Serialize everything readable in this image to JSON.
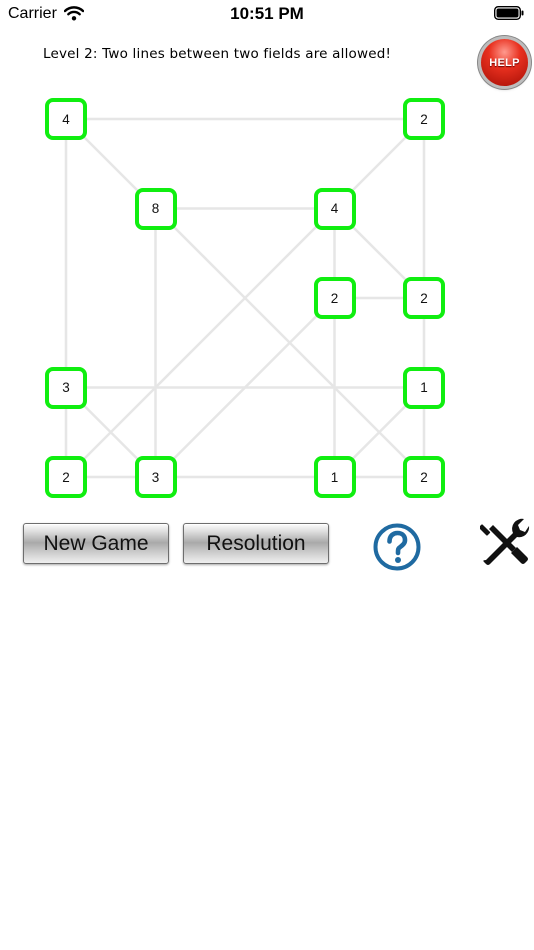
{
  "status_bar": {
    "carrier": "Carrier",
    "time": "10:51 PM"
  },
  "level_text": "Level 2: Two lines between two fields are allowed!",
  "help_button": "HELP",
  "nodes": [
    {
      "value": "4",
      "row": 0,
      "col": 0
    },
    {
      "value": "2",
      "row": 0,
      "col": 4
    },
    {
      "value": "8",
      "row": 1,
      "col": 1
    },
    {
      "value": "4",
      "row": 1,
      "col": 3
    },
    {
      "value": "2",
      "row": 2,
      "col": 3
    },
    {
      "value": "2",
      "row": 2,
      "col": 4
    },
    {
      "value": "3",
      "row": 3,
      "col": 0
    },
    {
      "value": "1",
      "row": 3,
      "col": 4
    },
    {
      "value": "2",
      "row": 4,
      "col": 0
    },
    {
      "value": "3",
      "row": 4,
      "col": 1
    },
    {
      "value": "1",
      "row": 4,
      "col": 3
    },
    {
      "value": "2",
      "row": 4,
      "col": 4
    }
  ],
  "connections": [
    [
      0,
      1
    ],
    [
      0,
      6
    ],
    [
      0,
      2
    ],
    [
      1,
      5
    ],
    [
      1,
      3
    ],
    [
      2,
      3
    ],
    [
      2,
      9
    ],
    [
      2,
      11
    ],
    [
      3,
      4
    ],
    [
      3,
      5
    ],
    [
      3,
      8
    ],
    [
      4,
      5
    ],
    [
      4,
      10
    ],
    [
      4,
      9
    ],
    [
      5,
      7
    ],
    [
      6,
      7
    ],
    [
      6,
      8
    ],
    [
      6,
      9
    ],
    [
      7,
      10
    ],
    [
      7,
      11
    ],
    [
      8,
      9
    ],
    [
      9,
      10
    ],
    [
      10,
      11
    ]
  ],
  "buttons": {
    "new_game": "New Game",
    "resolution": "Resolution"
  },
  "icons": {
    "question": "question-mark-icon",
    "tools": "screwdriver-wrench-icon"
  },
  "colors": {
    "node_border": "#10ee10",
    "line": "#e6e6e6",
    "help_red": "#e8301f",
    "question_blue": "#1f6aa1"
  }
}
